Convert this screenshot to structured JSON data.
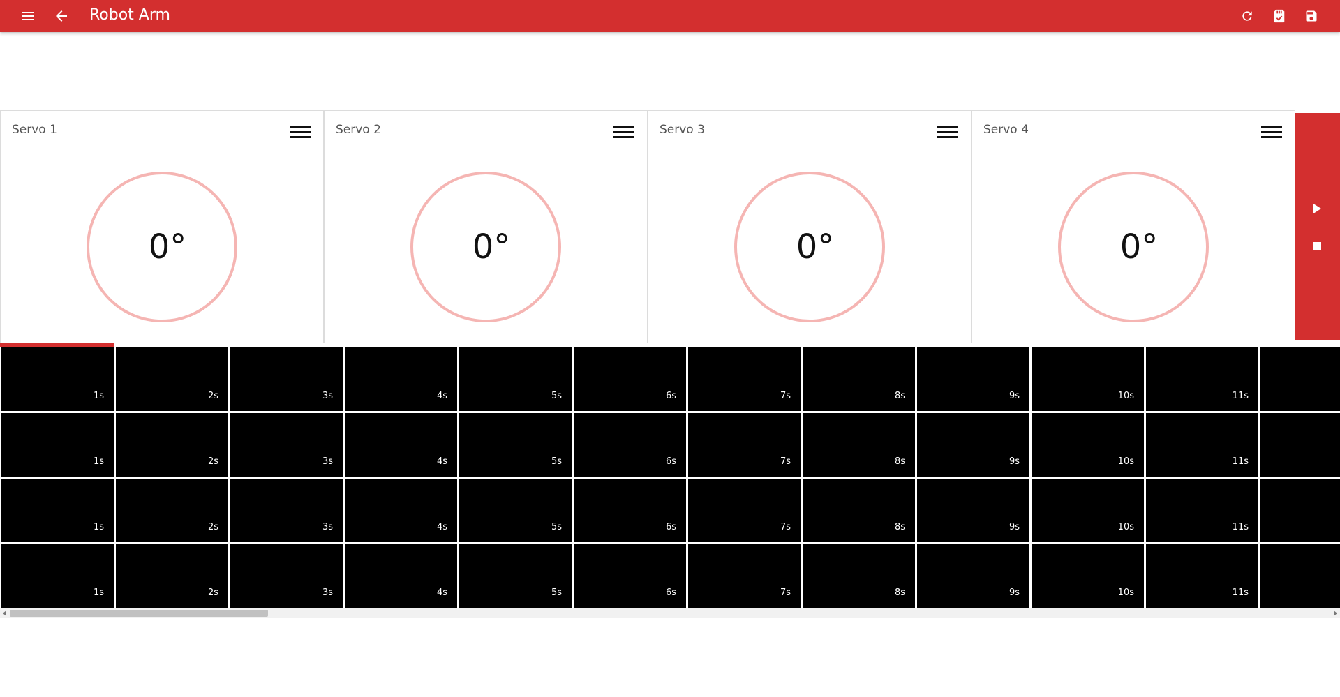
{
  "app": {
    "title": "Robot Arm",
    "accent": "#d32f2f",
    "dial_ring": "#f5b5b3"
  },
  "toolbar": {
    "menu_icon": "menu-icon",
    "back_icon": "arrow-back-icon",
    "actions": [
      "refresh-icon",
      "sd-card-check-icon",
      "save-icon"
    ]
  },
  "servos": [
    {
      "name": "Servo 1",
      "angle": "0°"
    },
    {
      "name": "Servo 2",
      "angle": "0°"
    },
    {
      "name": "Servo 3",
      "angle": "0°"
    },
    {
      "name": "Servo 4",
      "angle": "0°"
    }
  ],
  "controls": {
    "play_icon": "play-icon",
    "stop_icon": "stop-icon"
  },
  "timeline": {
    "rows": 4,
    "labels": [
      "1s",
      "2s",
      "3s",
      "4s",
      "5s",
      "6s",
      "7s",
      "8s",
      "9s",
      "10s",
      "11s",
      ""
    ]
  }
}
